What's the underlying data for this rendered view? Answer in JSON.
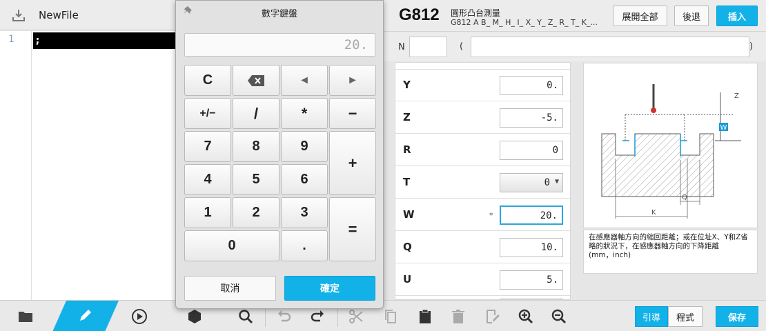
{
  "editor": {
    "file_name": "NewFile",
    "line_number": "1",
    "line_text": ";"
  },
  "header": {
    "gcode": "G812",
    "name": "圓形凸台測量",
    "signature": "G812 A B_ M_ H_ I_ X_ Y_ Z_ R_ T_ K_...",
    "expand_label": "展開全部",
    "back_label": "後退",
    "insert_label": "插入"
  },
  "block": {
    "n_label": "N",
    "n_value": "",
    "paren_open": "(",
    "comment_value": "",
    "paren_close": ")"
  },
  "params": [
    {
      "label": "Y",
      "value": "0."
    },
    {
      "label": "Z",
      "value": "-5."
    },
    {
      "label": "R",
      "value": "0"
    },
    {
      "label": "T",
      "value": "0"
    },
    {
      "label": "W",
      "value": "20.",
      "required": "*"
    },
    {
      "label": "Q",
      "value": "10."
    },
    {
      "label": "U",
      "value": "5."
    }
  ],
  "diagram": {
    "labels": {
      "z": "Z",
      "w": "W",
      "q": "Q",
      "k": "K"
    }
  },
  "description": {
    "text": "在感應器軸方向的縮回距離；或在位址X、Y和Z省略的狀況下，在感應器軸方向的下降距離",
    "units": "(mm，inch)"
  },
  "keypad": {
    "title": "數字鍵盤",
    "display_placeholder": "20.",
    "keys": {
      "clear": "C",
      "left": "◄",
      "right": "►",
      "sign": "+/−",
      "divide": "/",
      "multiply": "*",
      "minus": "−",
      "k7": "7",
      "k8": "8",
      "k9": "9",
      "plus": "+",
      "k4": "4",
      "k5": "5",
      "k6": "6",
      "k1": "1",
      "k2": "2",
      "k3": "3",
      "equals": "=",
      "k0": "0",
      "dot": "."
    },
    "cancel_label": "取消",
    "ok_label": "確定"
  },
  "toolbar": {
    "guide_label": "引導",
    "program_label": "程式",
    "save_label": "保存"
  },
  "colors": {
    "accent": "#12b2e8",
    "probe_tip": "#d23030"
  }
}
